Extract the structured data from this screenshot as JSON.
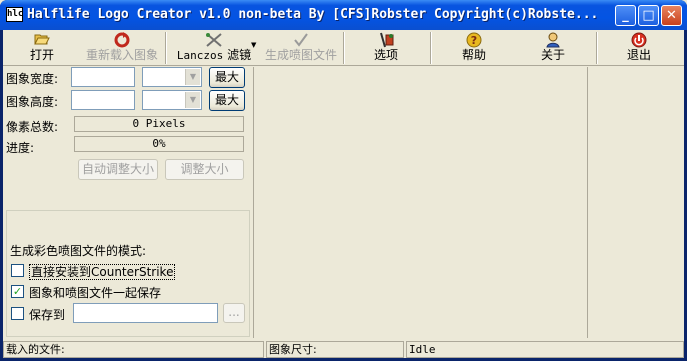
{
  "window": {
    "icon_text": "hlc",
    "title": "Halflife Logo Creator v1.0 non-beta By [CFS]Robster Copyright(c)Robste...",
    "minimize_glyph": "_",
    "maximize_glyph": "□",
    "close_glyph": "✕"
  },
  "toolbar": {
    "open": {
      "label": "打开",
      "icon": "folder-open-icon"
    },
    "reload": {
      "label": "重新载入图象",
      "icon": "reload-icon"
    },
    "filter": {
      "label": "滤镜",
      "value": "Lanczos",
      "icon": "filter-tools-icon"
    },
    "generate": {
      "label": "生成喷图文件",
      "icon": "checkmark-icon"
    },
    "options": {
      "label": "选项",
      "icon": "options-icon"
    },
    "help": {
      "label": "帮助",
      "icon": "help-icon"
    },
    "about": {
      "label": "关于",
      "icon": "about-icon"
    },
    "exit": {
      "label": "退出",
      "icon": "exit-icon"
    }
  },
  "settings": {
    "width_label": "图象宽度:",
    "height_label": "图象高度:",
    "max_label": "最大",
    "pixels_label": "像素总数:",
    "pixels_value": "0 Pixels",
    "progress_label": "进度:",
    "progress_value": "0%",
    "progress_fraction": 0,
    "auto_resize_label": "自动调整大小",
    "resize_label": "调整大小"
  },
  "mode": {
    "title": "生成彩色喷图文件的模式:",
    "install_label": "直接安装到CounterStrike",
    "install_checked": false,
    "save_together_label": "图象和喷图文件一起保存",
    "save_together_checked": true,
    "save_to_label": "保存到",
    "save_to_checked": false,
    "browse_label": "..."
  },
  "status": {
    "loaded_file_label": "载入的文件:",
    "spray_size_label": "图象尺寸:",
    "state": "Idle"
  },
  "colors": {
    "titlebar": "#0454e3",
    "face": "#ece9d8",
    "border": "#aca899"
  }
}
